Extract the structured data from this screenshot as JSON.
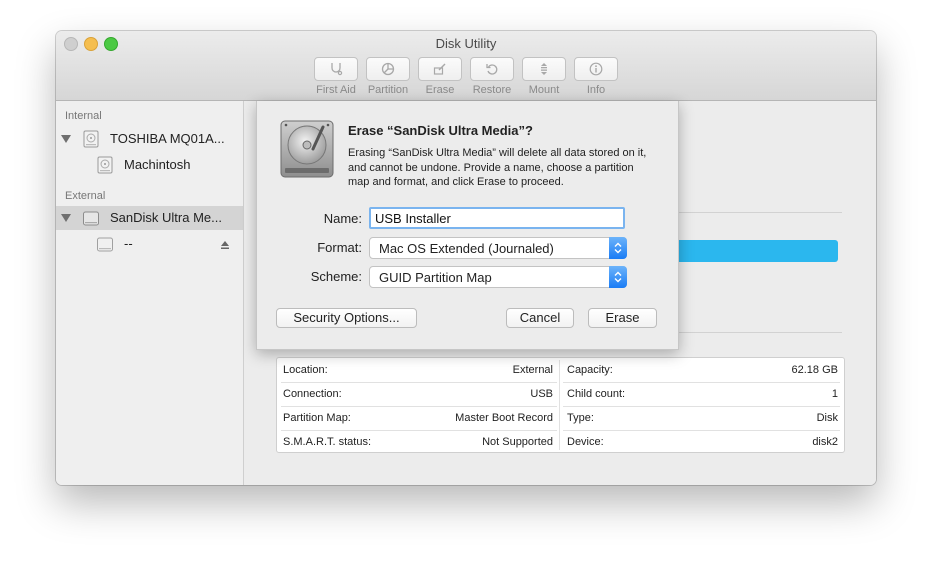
{
  "window": {
    "title": "Disk Utility"
  },
  "toolbar": [
    {
      "label": "First Aid",
      "icon": "stethoscope-icon"
    },
    {
      "label": "Partition",
      "icon": "pie-chart-icon"
    },
    {
      "label": "Erase",
      "icon": "erase-icon"
    },
    {
      "label": "Restore",
      "icon": "restore-icon"
    },
    {
      "label": "Mount",
      "icon": "mount-icon"
    },
    {
      "label": "Info",
      "icon": "info-icon"
    }
  ],
  "sidebar": {
    "internal_header": "Internal",
    "external_header": "External",
    "items": [
      {
        "label": "TOSHIBA MQ01A..."
      },
      {
        "label": "Machintosh"
      },
      {
        "label": "SanDisk Ultra Me..."
      },
      {
        "label": "--"
      }
    ]
  },
  "dialog": {
    "title": "Erase “SanDisk Ultra Media”?",
    "message": "Erasing “SanDisk Ultra Media” will delete all data stored on it, and cannot be undone. Provide a name, choose a partition map and format, and click Erase to proceed.",
    "name_label": "Name:",
    "name_value": "USB Installer",
    "format_label": "Format:",
    "format_value": "Mac OS Extended (Journaled)",
    "scheme_label": "Scheme:",
    "scheme_value": "GUID Partition Map",
    "security_button": "Security Options...",
    "cancel_button": "Cancel",
    "erase_button": "Erase"
  },
  "info": {
    "left": [
      {
        "key": "Location:",
        "value": "External"
      },
      {
        "key": "Connection:",
        "value": "USB"
      },
      {
        "key": "Partition Map:",
        "value": "Master Boot Record"
      },
      {
        "key": "S.M.A.R.T. status:",
        "value": "Not Supported"
      }
    ],
    "right": [
      {
        "key": "Capacity:",
        "value": "62.18 GB"
      },
      {
        "key": "Child count:",
        "value": "1"
      },
      {
        "key": "Type:",
        "value": "Disk"
      },
      {
        "key": "Device:",
        "value": "disk2"
      }
    ]
  },
  "colors": {
    "accent": "#2bb7ee",
    "select_stepper": "#1a7cf5",
    "focus_ring": "#7ab4ef"
  }
}
